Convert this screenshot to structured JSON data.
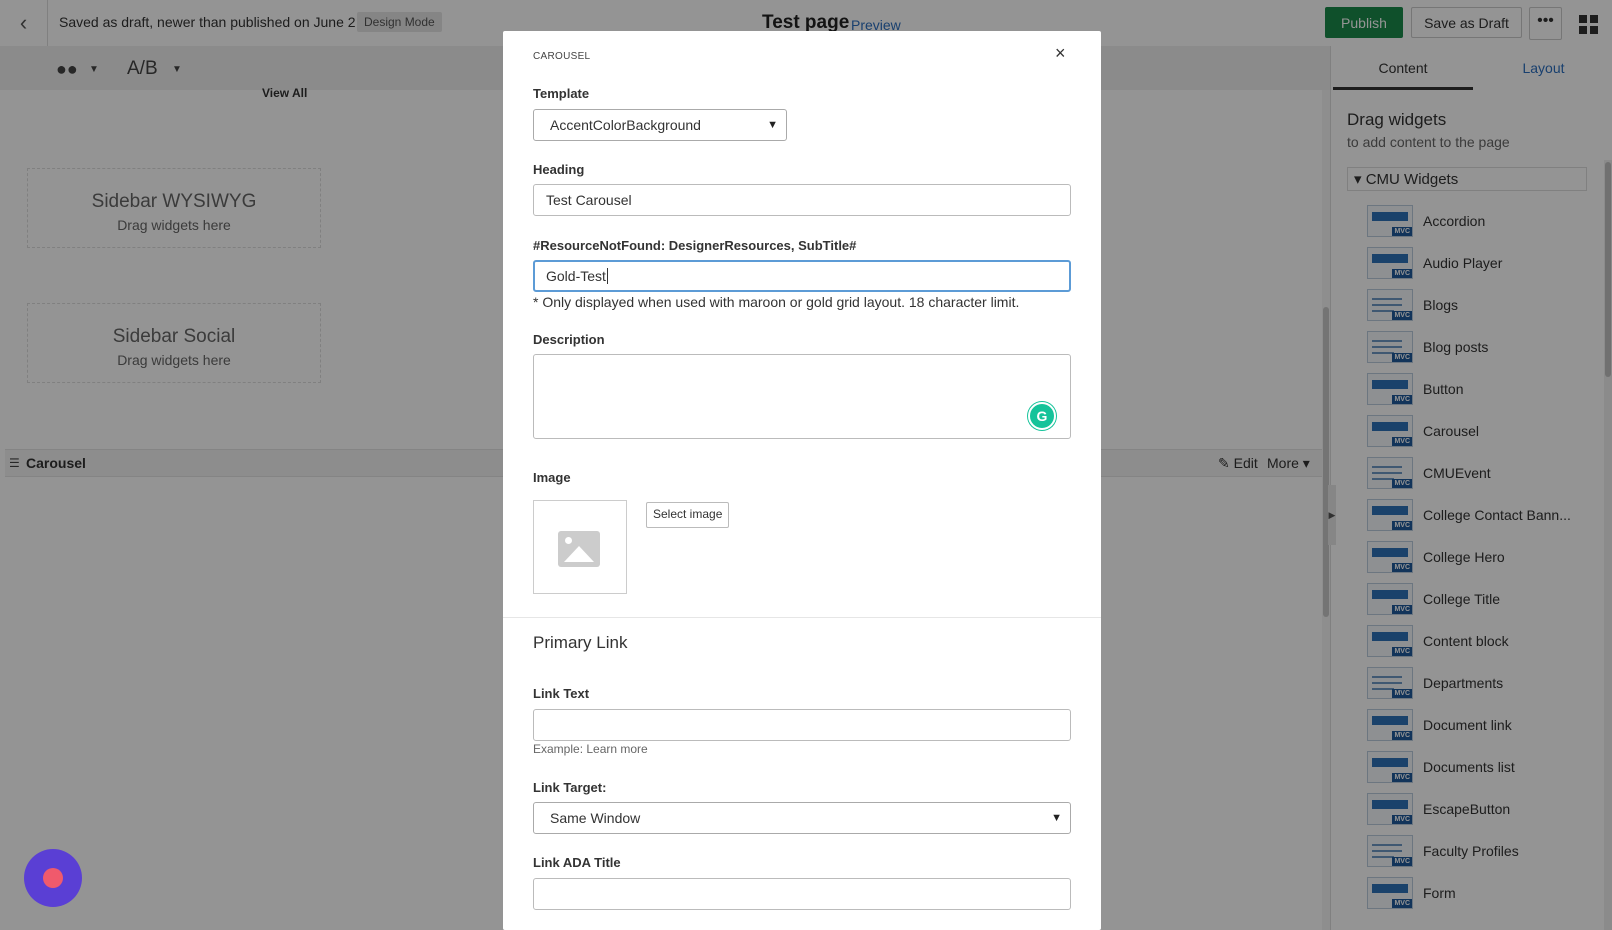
{
  "topbar": {
    "back_icon": "chevron-left-icon",
    "draft_status": "Saved as draft, newer than published on June 2",
    "design_mode": "Design Mode",
    "page_title": "Test page",
    "preview": "Preview",
    "publish": "Publish",
    "save_draft": "Save as Draft",
    "more": "•••"
  },
  "toolbar": {
    "ab": "A/B"
  },
  "canvas": {
    "view_all": "View All",
    "sidebar_wysiwyg": {
      "title": "Sidebar WYSIWYG",
      "sub": "Drag widgets here"
    },
    "sidebar_social": {
      "title": "Sidebar Social",
      "sub": "Drag widgets here"
    },
    "carousel_bar": {
      "label": "Carousel",
      "edit": "Edit",
      "more": "More"
    }
  },
  "right_panel": {
    "tabs": [
      "Content",
      "Layout"
    ],
    "drag_title": "Drag widgets",
    "drag_sub": "to add content to the page",
    "section": "CMU Widgets",
    "widgets": [
      "Accordion",
      "Audio Player",
      "Blogs",
      "Blog posts",
      "Button",
      "Carousel",
      "CMUEvent",
      "College Contact Bann...",
      "College Hero",
      "College Title",
      "Content block",
      "Departments",
      "Document link",
      "Documents list",
      "EscapeButton",
      "Faculty Profiles",
      "Form"
    ],
    "mvc": "MVC"
  },
  "modal": {
    "kicker": "CAROUSEL",
    "close": "×",
    "template_label": "Template",
    "template_value": "AccentColorBackground",
    "heading_label": "Heading",
    "heading_value": "Test Carousel",
    "subtitle_label": "#ResourceNotFound: DesignerResources, SubTitle#",
    "subtitle_value": "Gold-Test",
    "subtitle_help": "* Only displayed when used with maroon or gold grid layout. 18 character limit.",
    "description_label": "Description",
    "image_label": "Image",
    "select_image": "Select image",
    "primary_link": "Primary Link",
    "link_text_label": "Link Text",
    "link_text_example": "Example: Learn more",
    "link_target_label": "Link Target:",
    "link_target_value": "Same Window",
    "link_ada_label": "Link ADA Title"
  },
  "colors": {
    "publish_green": "#1a8a4a",
    "link_blue": "#2c6fbf",
    "focus_blue": "#5c9bd6",
    "grammarly_green": "#15c39a",
    "chat_purple": "#5a3fd4"
  }
}
